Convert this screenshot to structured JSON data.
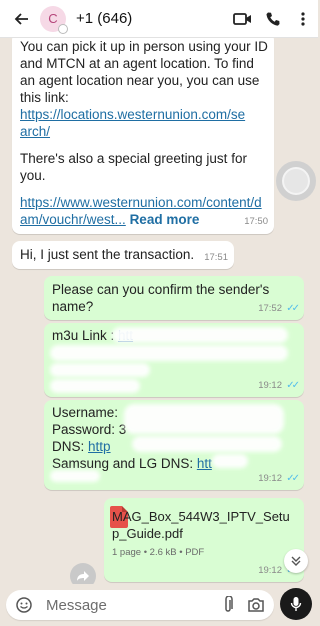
{
  "header": {
    "avatar_letter": "C",
    "contact": "+1 (646)",
    "icons": [
      "back-arrow-icon",
      "video-call-icon",
      "phone-icon",
      "more-vertical-icon"
    ]
  },
  "messages": {
    "m1": {
      "p1": "You can pick it up in person using your ID and MTCN at an agent location. To find an agent location near you, you can use this link:",
      "link1": "https://locations.westernunion.com/search/",
      "p2": "There's also a special greeting just for you.",
      "link2": "https://www.westernunion.com/content/dam/vouchr/west...",
      "read_more": "Read more",
      "time": "17:50"
    },
    "m2": {
      "text": "Hi, I just sent the transaction.",
      "time": "17:51"
    },
    "m3": {
      "text": "Please can you confirm the sender's name?",
      "time": "17:52",
      "ticks": "✓✓"
    },
    "m4": {
      "label": "m3u Link :",
      "link_start": "htt",
      "time": "19:12",
      "ticks": "✓✓"
    },
    "m5": {
      "username": "Username:",
      "password": "Password: 3",
      "dns": "DNS:",
      "dns_link": "http",
      "samsung": "Samsung and LG DNS:",
      "samsung_link": "htt",
      "time": "19:12",
      "ticks": "✓✓"
    },
    "m6": {
      "filename": "MAG_Box_544W3_IPTV_Setup_Guide.pdf",
      "meta": "1 page • 2.6 kB • PDF",
      "time": "19:12",
      "ticks": "✓✓"
    }
  },
  "input": {
    "placeholder": "Message"
  },
  "colors": {
    "incoming": "#ffffff",
    "outgoing": "#d9fdd3",
    "link": "#1f6ea3",
    "ticks": "#53bdeb",
    "background": "#ece5dd"
  }
}
